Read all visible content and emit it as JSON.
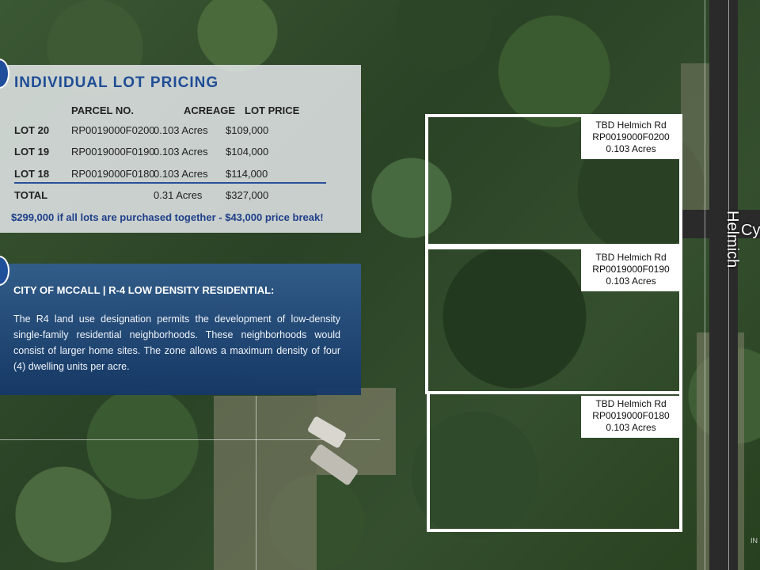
{
  "pricing": {
    "title": "INDIVIDUAL LOT PRICING",
    "headers": {
      "parcel": "PARCEL NO.",
      "acreage": "ACREAGE",
      "price": "LOT PRICE"
    },
    "rows": [
      {
        "lot": "LOT 20",
        "parcel": "RP0019000F0200",
        "acreage": "0.103 Acres",
        "price": "$109,000"
      },
      {
        "lot": "LOT 19",
        "parcel": "RP0019000F0190",
        "acreage": "0.103 Acres",
        "price": "$104,000"
      },
      {
        "lot": "LOT 18",
        "parcel": "RP0019000F0180",
        "acreage": "0.103 Acres",
        "price": "$114,000"
      }
    ],
    "total": {
      "label": "TOTAL",
      "acreage": "0.31 Acres",
      "price": "$327,000"
    },
    "deal": "$299,000 if all lots are purchased together - $43,000 price break!"
  },
  "zoning": {
    "title": "CITY OF MCCALL | R-4 LOW DENSITY RESIDENTIAL:",
    "body": "The R4 land use designation permits the development of low-density single-family residential neighborhoods. These neighborhoods would consist of larger home sites. The zone allows a maximum density of four (4) dwelling units per acre."
  },
  "lots": [
    {
      "street": "TBD Helmich Rd",
      "parcel": "RP0019000F0200",
      "acreage": "0.103 Acres"
    },
    {
      "street": "TBD Helmich Rd",
      "parcel": "RP0019000F0190",
      "acreage": "0.103 Acres"
    },
    {
      "street": "TBD Helmich Rd",
      "parcel": "RP0019000F0180",
      "acreage": "0.103 Acres"
    }
  ],
  "map": {
    "street_helmich": "Helmich",
    "street_cy": "Cy",
    "watermark": "IN"
  },
  "colors": {
    "accent": "#1f4d96",
    "panel_blue": "#1c4a8a"
  }
}
